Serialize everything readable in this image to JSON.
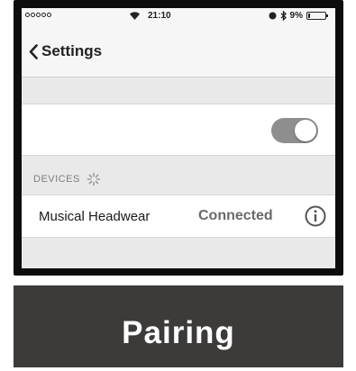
{
  "status_bar": {
    "signal_dots": [
      false,
      false,
      false,
      false,
      false
    ],
    "wifi_icon": "wifi-icon",
    "time": "21:10",
    "battery_percent_label": "9%",
    "battery_level": 0.09,
    "icons": [
      "lock-rotation-icon",
      "bluetooth-icon",
      "battery-icon"
    ]
  },
  "nav": {
    "back_icon": "chevron-left-icon",
    "back_label": "Settings"
  },
  "bluetooth_toggle": {
    "state": "on",
    "track_color": "#8e8e8e"
  },
  "devices_section": {
    "header": "DEVICES",
    "spinner_icon": "loading-spinner-icon"
  },
  "device": {
    "name": "Musical Headwear",
    "status": "Connected",
    "info_icon": "info-circle-icon"
  },
  "caption": {
    "text": "Pairing"
  }
}
